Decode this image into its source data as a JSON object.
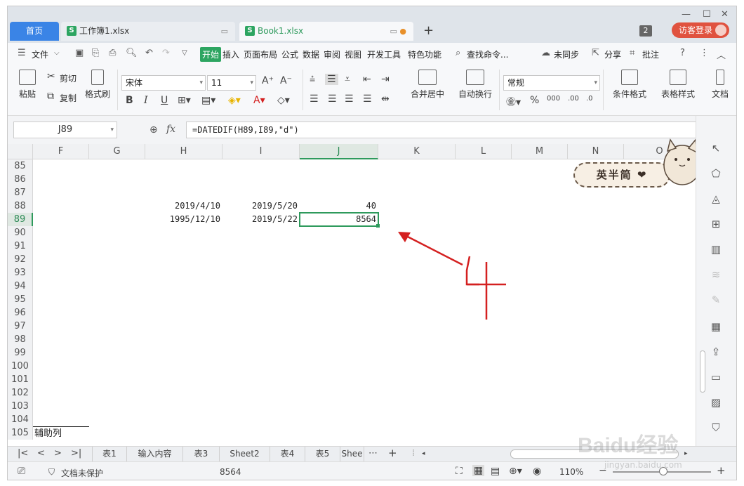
{
  "titlebar": {
    "home_tab": "首页",
    "tabs": [
      {
        "label": "工作簿1.xlsx",
        "icon": "S"
      },
      {
        "label": "Book1.xlsx",
        "icon": "S"
      }
    ],
    "window_count": "2",
    "login_label": "访客登录"
  },
  "menubar": {
    "file_label": "文件",
    "items": [
      "开始",
      "插入",
      "页面布局",
      "公式",
      "数据",
      "审阅",
      "视图",
      "开发工具",
      "特色功能"
    ],
    "search_label": "查找命令...",
    "unsync_label": "未同步",
    "share_label": "分享",
    "comment_label": "批注"
  },
  "ribbon": {
    "paste": "粘贴",
    "cut": "剪切",
    "copy": "复制",
    "format_painter": "格式刷",
    "font_name": "宋体",
    "font_size": "11",
    "merge_center": "合并居中",
    "wrap_text": "自动换行",
    "number_format": "常规",
    "conditional_format": "条件格式",
    "table_style": "表格样式",
    "doc_label": "文档"
  },
  "formulabar": {
    "cell_ref": "J89",
    "fx": "fx",
    "formula": "=DATEDIF(H89,I89,\"d\")"
  },
  "columns": [
    "F",
    "G",
    "H",
    "I",
    "J",
    "K",
    "L",
    "M",
    "N",
    "O"
  ],
  "rows": [
    "85",
    "86",
    "87",
    "88",
    "89",
    "90",
    "91",
    "92",
    "93",
    "94",
    "95",
    "96",
    "97",
    "98",
    "99",
    "100",
    "101",
    "102",
    "103",
    "104",
    "105"
  ],
  "cells": {
    "H88": "2019/4/10",
    "I88": "2019/5/20",
    "J88": "40",
    "H89": "1995/12/10",
    "I89": "2019/5/22",
    "J89": "8564",
    "F105": "辅助列"
  },
  "sheets": [
    "表1",
    "输入内容",
    "表3",
    "Sheet2",
    "表4",
    "表5",
    "Shee"
  ],
  "statusbar": {
    "protect_label": "文档未保护",
    "sum_value": "8564",
    "zoom": "110%"
  },
  "sticker_text": "英半简",
  "watermark": "Baidu经验",
  "watermark_url": "jingyan.baidu.com",
  "colors": {
    "accent": "#2e9a5c",
    "home_tab": "#3a84e6",
    "login": "#e0523f",
    "arrow": "#d42020"
  }
}
